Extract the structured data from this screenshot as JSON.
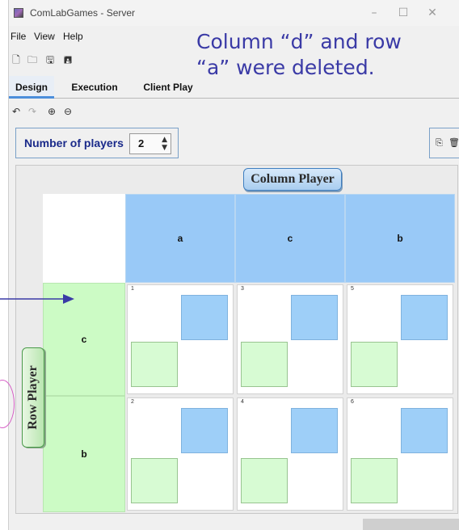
{
  "window": {
    "title": "ComLabGames - Server",
    "controls": [
      "–",
      "☐",
      "✕"
    ]
  },
  "menu": [
    "File",
    "View",
    "Help"
  ],
  "toolbar_icons": [
    "new-file-icon",
    "open-folder-icon",
    "save-icon",
    "save-as-icon"
  ],
  "tabs": [
    {
      "label": "Design",
      "active": true
    },
    {
      "label": "Execution",
      "active": false
    },
    {
      "label": "Client Play",
      "active": false
    }
  ],
  "subtoolbar_icons": [
    "undo-icon",
    "redo-icon",
    "zoom-in-icon",
    "zoom-out-icon"
  ],
  "players": {
    "label": "Number of players",
    "value": "2"
  },
  "right_icons": [
    "add-icon",
    "delete-icon"
  ],
  "annotation": {
    "line1": "Column “d” and row",
    "line2": "“a” were deleted."
  },
  "column_player": "Column Player",
  "row_player": "Row Player",
  "columns": [
    "a",
    "c",
    "b"
  ],
  "rows": [
    "c",
    "b"
  ],
  "cell_numbers": [
    [
      "1",
      "3",
      "5"
    ],
    [
      "2",
      "4",
      "6"
    ]
  ],
  "colors": {
    "column_header": "#99c9f7",
    "row_header": "#ccfbc5",
    "payoff_blue": "#9ecff8",
    "payoff_green": "#d7fbd3",
    "annotation": "#3a3aa6"
  }
}
